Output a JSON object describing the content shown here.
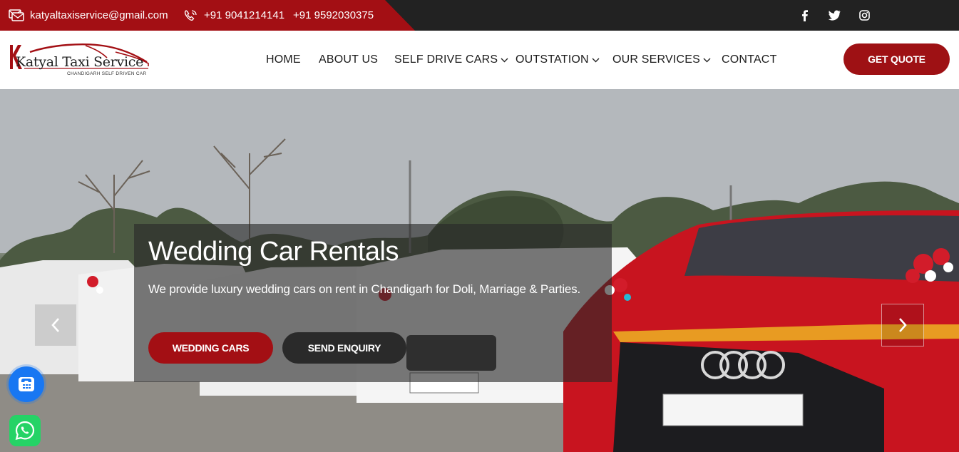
{
  "topbar": {
    "email": "katyaltaxiservice@gmail.com",
    "phone_1": "+91 9041214141",
    "phone_2": "+91 9592030375",
    "social": [
      "facebook-icon",
      "twitter-icon",
      "instagram-icon"
    ]
  },
  "logo": {
    "name": "Katyal Taxi Service",
    "tagline": "CHANDIGARH SELF DRIVEN CAR"
  },
  "nav": {
    "items": [
      {
        "label": "HOME",
        "dropdown": false
      },
      {
        "label": "ABOUT US",
        "dropdown": false
      },
      {
        "label": "SELF DRIVE CARS",
        "dropdown": true
      },
      {
        "label": "OUTSTATION",
        "dropdown": true
      },
      {
        "label": "OUR SERVICES",
        "dropdown": true
      },
      {
        "label": "CONTACT",
        "dropdown": false
      }
    ],
    "cta": "GET QUOTE"
  },
  "hero": {
    "title": "Wedding Car Rentals",
    "text": "We provide luxury wedding cars on rent in Chandigarh for Doli, Marriage & Parties.",
    "primary_button": "WEDDING CARS",
    "secondary_button": "SEND ENQUIRY",
    "prev_icon": "chevron-left-icon",
    "next_icon": "chevron-right-icon"
  },
  "floating": {
    "phone_icon": "phone-icon",
    "whatsapp_icon": "whatsapp-icon"
  },
  "colors": {
    "brand_red": "#a30f14",
    "dark": "#222222",
    "whatsapp": "#25d366",
    "call": "#1877f2"
  }
}
